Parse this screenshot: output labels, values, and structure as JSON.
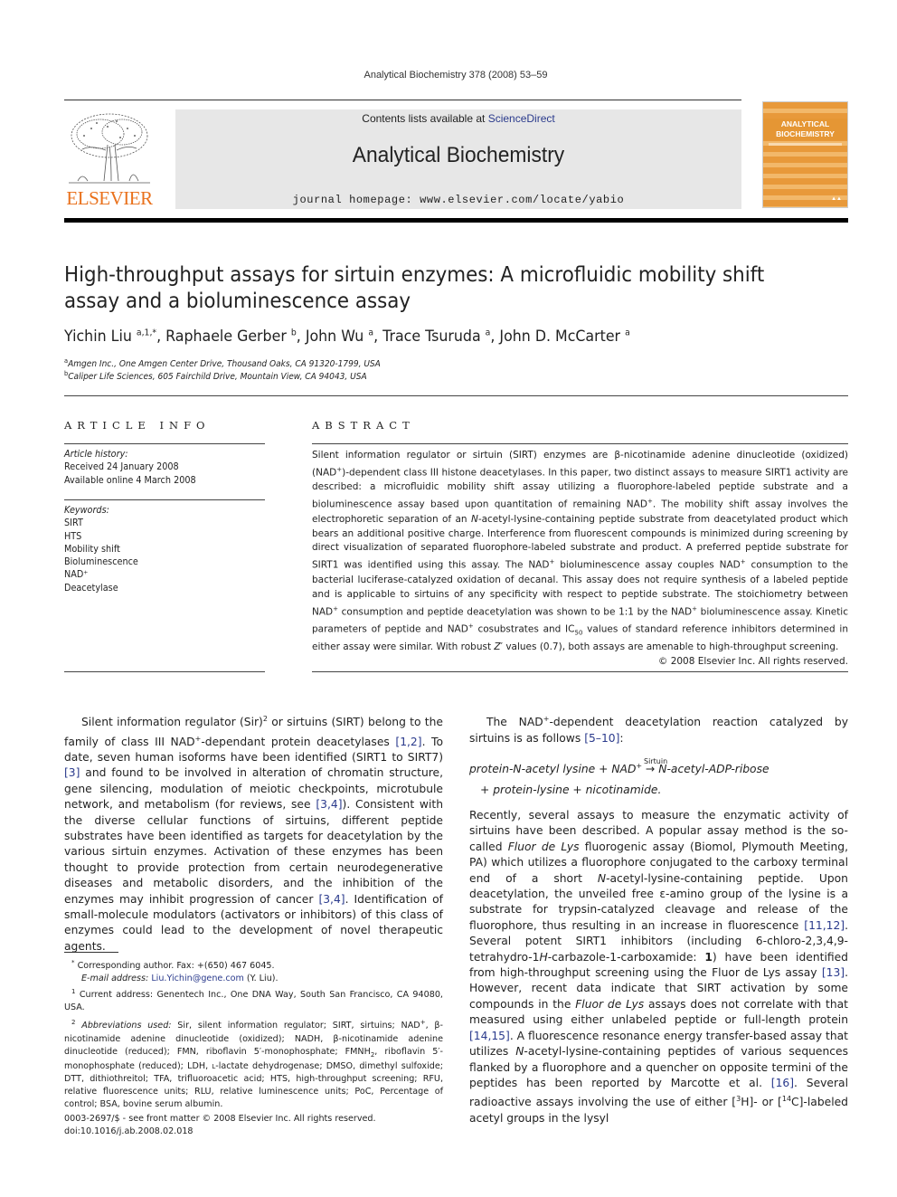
{
  "header": {
    "citation": "Analytical Biochemistry 378 (2008) 53–59",
    "contents_prefix": "Contents lists available at ",
    "contents_link": "ScienceDirect",
    "journal_title": "Analytical Biochemistry",
    "homepage": "journal homepage: www.elsevier.com/locate/yabio",
    "publisher_logo": "ELSEVIER",
    "cover_title_1": "ANALYTICAL",
    "cover_title_2": "BIOCHEMISTRY",
    "colors": {
      "elsevier_orange": "#e9711c",
      "link_blue": "#2a3a8c",
      "banner_gray": "#e7e7e7",
      "cover_orange": "#e8993a"
    }
  },
  "article": {
    "title": "High-throughput assays for sirtuin enzymes: A microfluidic mobility shift assay and a bioluminescence assay",
    "authors": [
      {
        "name": "Yichin Liu",
        "sup": "a,1,*"
      },
      {
        "name": "Raphaele Gerber",
        "sup": "b"
      },
      {
        "name": "John Wu",
        "sup": "a"
      },
      {
        "name": "Trace Tsuruda",
        "sup": "a"
      },
      {
        "name": "John D. McCarter",
        "sup": "a"
      }
    ],
    "affiliations": [
      {
        "mark": "a",
        "text": "Amgen Inc., One Amgen Center Drive, Thousand Oaks, CA 91320-1799, USA"
      },
      {
        "mark": "b",
        "text": "Caliper Life Sciences, 605 Fairchild Drive, Mountain View, CA 94043, USA"
      }
    ]
  },
  "article_info": {
    "heading": "ARTICLE INFO",
    "history_label": "Article history:",
    "received": "Received 24 January 2008",
    "available": "Available online 4 March 2008",
    "keywords_label": "Keywords:",
    "keywords": [
      "SIRT",
      "HTS",
      "Mobility shift",
      "Bioluminescence",
      "NAD⁺",
      "Deacetylase"
    ]
  },
  "abstract": {
    "heading": "ABSTRACT",
    "copyright": "© 2008 Elsevier Inc. All rights reserved."
  },
  "body": {
    "left_para_refs": [
      "[1,2]",
      "[3]",
      "[3,4]",
      "[3,4]"
    ],
    "right_intro_ref": "[5–10]",
    "equation_arrow_label": "Sirtuin",
    "right_refs": [
      "[11,12]",
      "[13]",
      "[14,15]",
      "[16]"
    ]
  },
  "footnotes": {
    "corresponding": "Corresponding author. Fax: +(650) 467 6045.",
    "email_label": "E-mail address:",
    "email": "Liu.Yichin@gene.com",
    "email_suffix": " (Y. Liu).",
    "current_address": "Current address: Genentech Inc., One DNA Way, South San Francisco, CA 94080, USA.",
    "abbrev_label": "Abbreviations used:"
  },
  "front_matter": {
    "issn": "0003-2697/$ - see front matter © 2008 Elsevier Inc. All rights reserved.",
    "doi": "doi:10.1016/j.ab.2008.02.018"
  }
}
